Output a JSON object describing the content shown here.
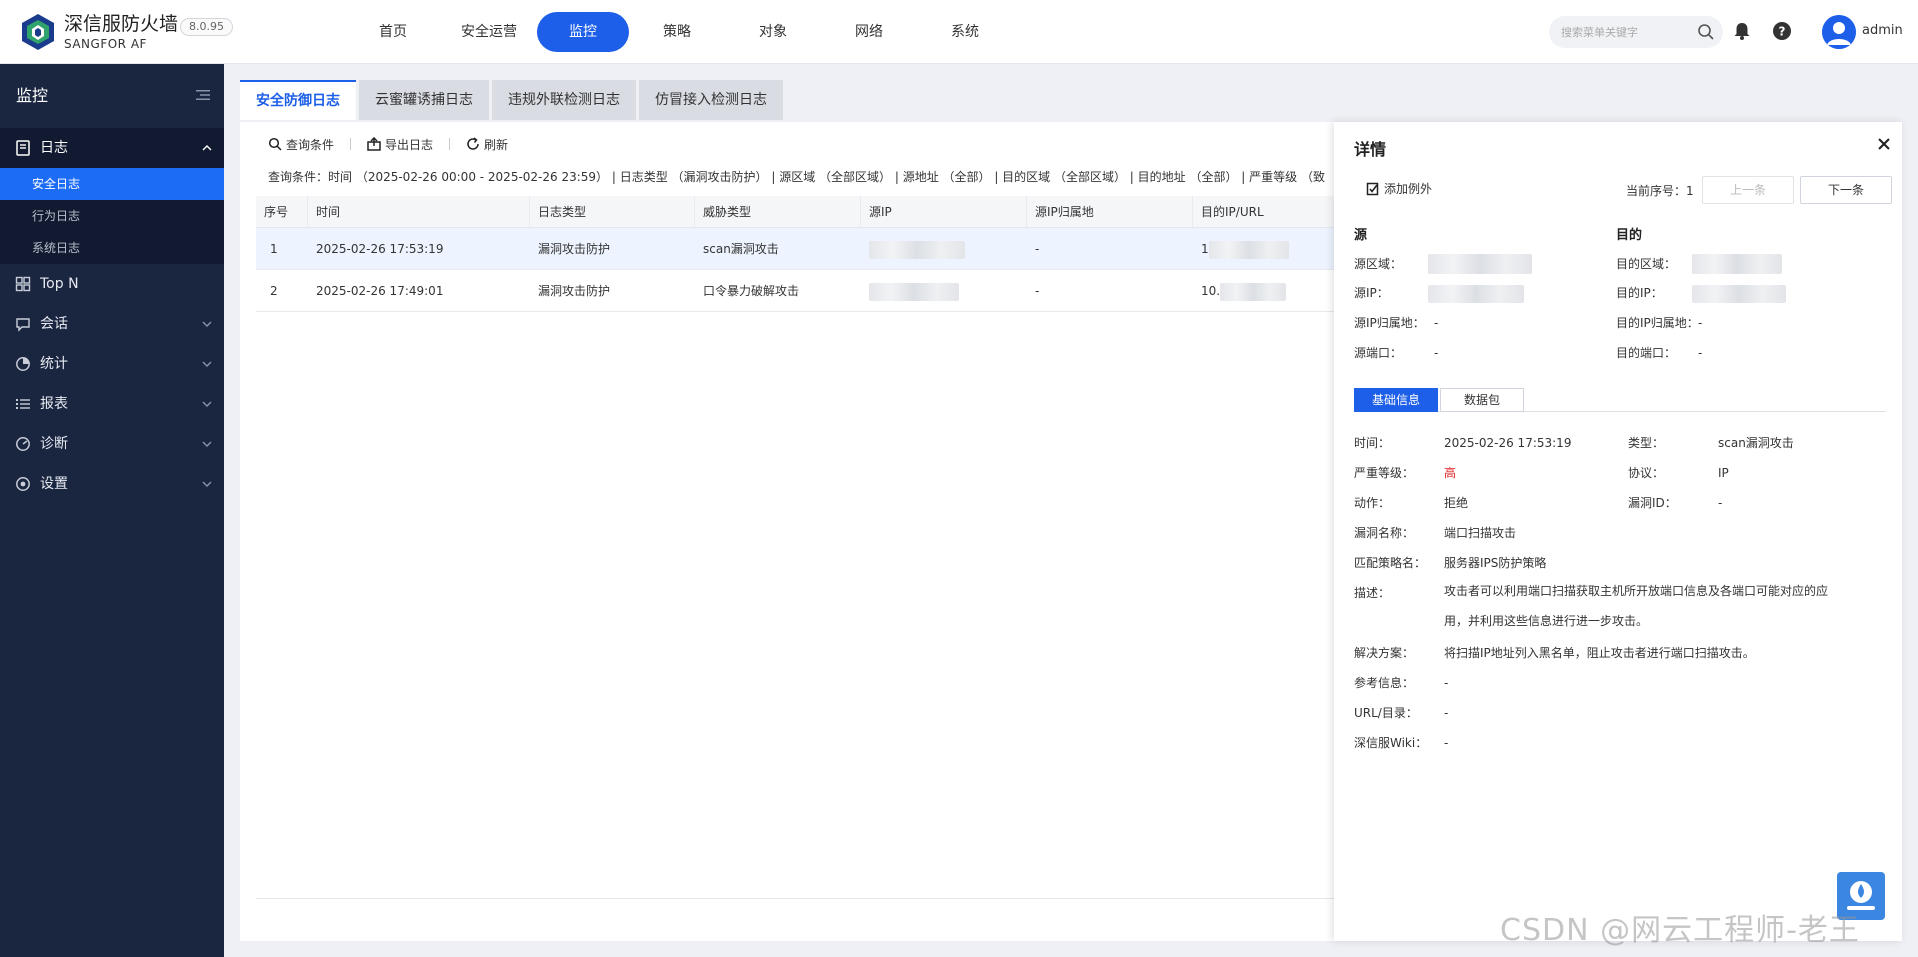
{
  "app": {
    "name": "深信服防火墙",
    "sub": "SANGFOR AF",
    "version": "8.0.95",
    "username": "admin",
    "accent": "#1d5fe8"
  },
  "nav": {
    "items": [
      "首页",
      "安全运营",
      "监控",
      "策略",
      "对象",
      "网络",
      "系统"
    ],
    "active": "监控"
  },
  "search": {
    "placeholder": "搜索菜单关键字"
  },
  "icons": {
    "search": "search-icon",
    "bell": "bell-icon",
    "help": "help-icon",
    "avatar": "user-avatar-icon"
  },
  "sidebar": {
    "title": "监控",
    "log_group": "日志",
    "log_items": [
      "安全日志",
      "行为日志",
      "系统日志"
    ],
    "groups": [
      "Top N",
      "会话",
      "统计",
      "报表",
      "诊断",
      "设置"
    ]
  },
  "tabs": [
    "安全防御日志",
    "云蜜罐诱捕日志",
    "违规外联检测日志",
    "仿冒接入检测日志"
  ],
  "toolbar": {
    "query": "查询条件",
    "export": "导出日志",
    "refresh": "刷新"
  },
  "filter": "查询条件：时间 （2025-02-26 00:00 - 2025-02-26 23:59） | 日志类型 （漏洞攻击防护） | 源区域 （全部区域） | 源地址 （全部） | 目的区域 （全部区域） | 目的地址 （全部） | 严重等级 （致",
  "table": {
    "headers": [
      "序号",
      "时间",
      "日志类型",
      "威胁类型",
      "源IP",
      "源IP归属地",
      "目的IP/URL"
    ],
    "rows": [
      [
        "1",
        "2025-02-26 17:53:19",
        "漏洞攻击防护",
        "scan漏洞攻击",
        "",
        "-",
        "1"
      ],
      [
        "2",
        "2025-02-26 17:49:01",
        "漏洞攻击防护",
        "口令暴力破解攻击",
        "",
        "-",
        "10."
      ]
    ]
  },
  "detail": {
    "title": "详情",
    "add_exception": "添加例外",
    "current_index_label": "当前序号：",
    "current_index": "1",
    "prev": "上一条",
    "next": "下一条",
    "src_title": "源",
    "dst_title": "目的",
    "src_zone_label": "源区域：",
    "src_ip_label": "源IP：",
    "src_loc_label": "源IP归属地：",
    "src_loc": "-",
    "src_port_label": "源端口：",
    "src_port": "-",
    "dst_zone_label": "目的区域：",
    "dst_ip_label": "目的IP：",
    "dst_loc_label": "目的IP归属地：",
    "dst_loc": "-",
    "dst_port_label": "目的端口：",
    "dst_port": "-",
    "tab_basic": "基础信息",
    "tab_packet": "数据包",
    "time_label": "时间：",
    "time": "2025-02-26 17:53:19",
    "type_label": "类型：",
    "type": "scan漏洞攻击",
    "severity_label": "严重等级：",
    "severity": "高",
    "protocol_label": "协议：",
    "protocol": "IP",
    "action_label": "动作：",
    "action": "拒绝",
    "vuln_id_label": "漏洞ID：",
    "vuln_id": "-",
    "vuln_name_label": "漏洞名称：",
    "vuln_name": "端口扫描攻击",
    "policy_label": "匹配策略名：",
    "policy": "服务器IPS防护策略",
    "desc_label": "描述：",
    "desc": "攻击者可以利用端口扫描获取主机所开放端口信息及各端口可能对应的应用，并利用这些信息进行进一步攻击。",
    "solution_label": "解决方案：",
    "solution": "将扫描IP地址列入黑名单，阻止攻击者进行端口扫描攻击。",
    "ref_label": "参考信息：",
    "ref": "-",
    "url_label": "URL/目录：",
    "url": "-",
    "wiki_label": "深信服Wiki：",
    "wiki": "-",
    "severity_color": "#e02020"
  },
  "watermark": "CSDN @网云工程师-老王"
}
